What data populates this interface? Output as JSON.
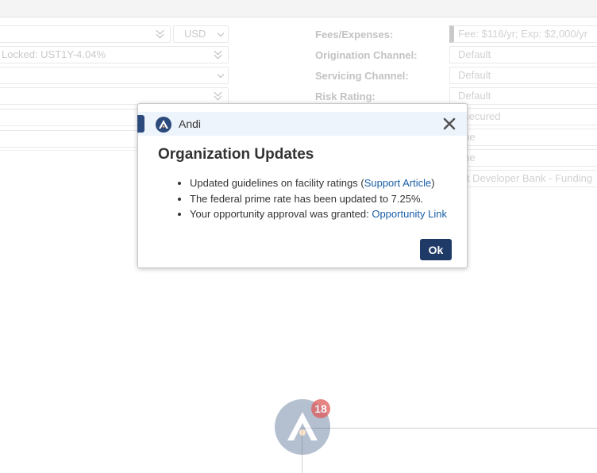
{
  "background_form": {
    "left_fields": [
      {
        "value": ""
      },
      {
        "value": "Locked: UST1Y-4.04%"
      },
      {
        "value": ""
      },
      {
        "value": ""
      },
      {
        "value": ""
      },
      {
        "value": ""
      }
    ],
    "currency": "USD",
    "right_labels": [
      "Fees/Expenses:",
      "Origination Channel:",
      "Servicing Channel:",
      "Risk Rating:"
    ],
    "right_fields": [
      "Fee: $116/yr; Exp: $2,000/yr",
      "Default",
      "Default",
      "Default",
      "nsecured",
      "one",
      "one",
      "rst Developer Bank - Funding"
    ]
  },
  "fab": {
    "badge_count": "18"
  },
  "modal": {
    "app_name": "Andi",
    "title": "Organization Updates",
    "items": {
      "item1_text": "Updated guidelines on facility ratings (",
      "item1_link": "Support Article",
      "item1_suffix": ")",
      "item2_text": "The federal prime rate has been updated to 7.25%.",
      "item3_text": "Your opportunity approval was granted: ",
      "item3_link": "Opportunity Link"
    },
    "ok_label": "Ok"
  },
  "colors": {
    "brand": "#2c4a7c",
    "button": "#1f3a66",
    "link": "#1a5fa8",
    "badge": "#e05b5b"
  }
}
